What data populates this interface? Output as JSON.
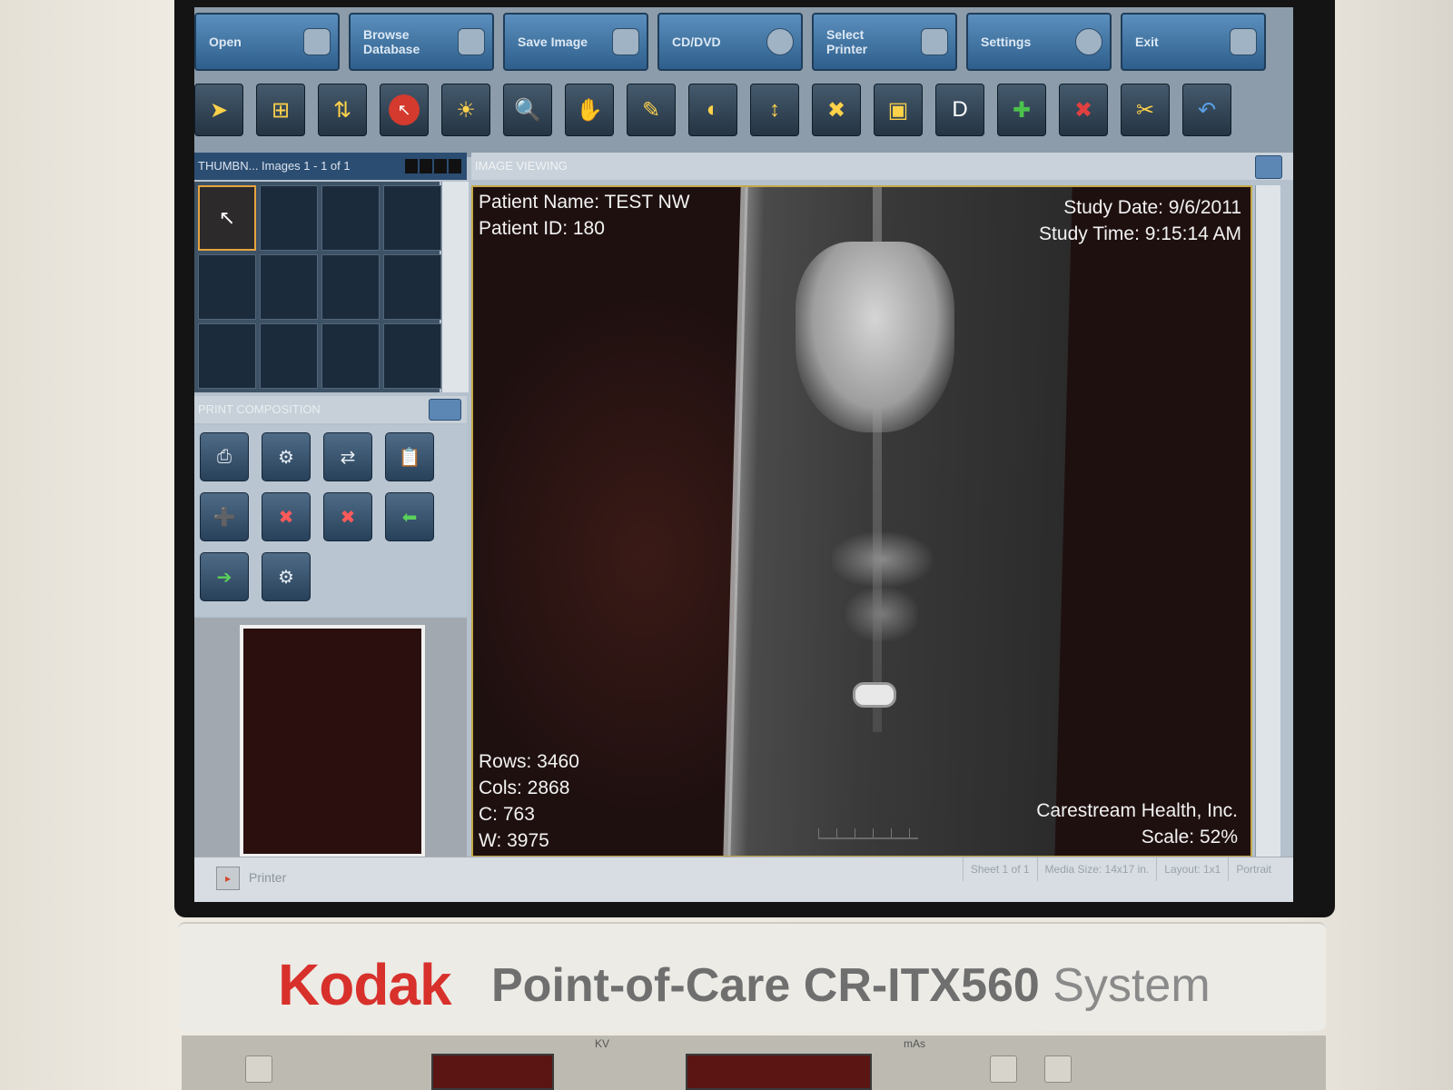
{
  "toolbar": {
    "buttons": [
      {
        "label": "Open",
        "icon": "folder-icon"
      },
      {
        "label": "Browse\nDatabase",
        "icon": "database-icon"
      },
      {
        "label": "Save Image",
        "icon": "save-icon"
      },
      {
        "label": "CD/DVD",
        "icon": "disc-icon"
      },
      {
        "label": "Select\nPrinter",
        "icon": "printer-icon"
      },
      {
        "label": "Settings",
        "icon": "gear-icon"
      },
      {
        "label": "Exit",
        "icon": "exit-icon"
      }
    ],
    "tools": [
      "pointer",
      "window-layout",
      "flip",
      "reset",
      "brightness",
      "zoom",
      "pan",
      "annotate",
      "invert",
      "measure",
      "markers",
      "roi",
      "text",
      "add-image",
      "delete-image",
      "crop",
      "undo"
    ]
  },
  "thumbnails": {
    "header": "THUMBN... Images 1 - 1 of 1"
  },
  "print_composition": {
    "header": "PRINT COMPOSITION"
  },
  "image_viewing": {
    "header": "IMAGE VIEWING",
    "overlay": {
      "patient_name": "Patient Name: TEST NW",
      "patient_id": "Patient ID: 180",
      "study_date": "Study Date: 9/6/2011",
      "study_time": "Study Time: 9:15:14 AM",
      "rows": "Rows: 3460",
      "cols": "Cols: 2868",
      "c": "C: 763",
      "w": "W: 3975",
      "company": "Carestream Health, Inc.",
      "scale": "Scale: 52%"
    }
  },
  "status_bar": {
    "printer": "Printer",
    "sheet": "Sheet 1 of 1",
    "media_size": "Media Size: 14x17 in.",
    "layout": "Layout: 1x1",
    "orientation": "Portrait"
  },
  "device": {
    "brand": "Kodak",
    "model": "Point-of-Care CR-ITX560",
    "suffix": "System",
    "panel_kv": "KV",
    "panel_mas": "mAs"
  },
  "colors": {
    "brand_red": "#d8302b",
    "toolbar_blue": "#2f5f8c",
    "selection_gold": "#e6a43d"
  }
}
